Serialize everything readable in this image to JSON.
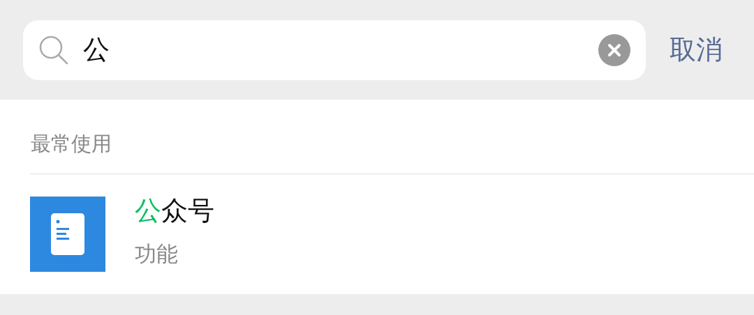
{
  "search": {
    "value": "公",
    "cancel": "取消"
  },
  "section": {
    "title": "最常使用",
    "items": [
      {
        "kind": "article",
        "title_match": "公",
        "title_rest": "众号",
        "subtitle": "功能"
      }
    ]
  }
}
